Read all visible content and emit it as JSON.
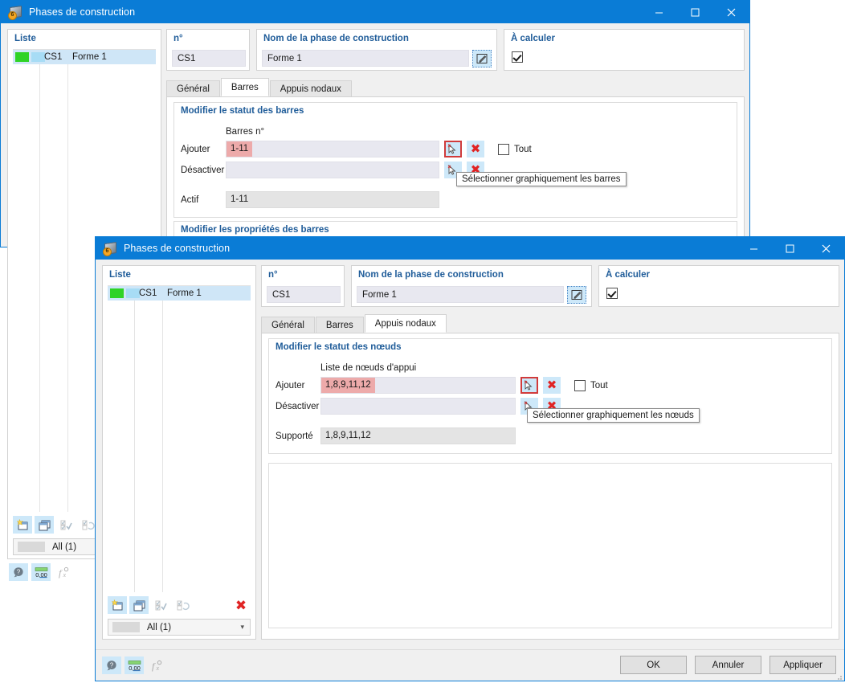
{
  "window1": {
    "title": "Phases de construction",
    "icon": "app-cube-icon",
    "controls": {
      "minimize": "minimize-icon",
      "maximize": "maximize-icon",
      "close": "close-icon"
    },
    "list": {
      "header": "Liste",
      "rows": [
        {
          "swatch1": "#2fd326",
          "swatch2": "#a7dcf5",
          "no": "CS1",
          "name": "Forme 1"
        }
      ],
      "toolbar": [
        "new-item-icon",
        "copy-item-icon",
        "check-all-icon",
        "toggle-check-icon"
      ],
      "filter": "All (1)"
    },
    "fields": {
      "no_label": "n°",
      "no_value": "CS1",
      "name_label": "Nom de la phase de construction",
      "name_value": "Forme 1",
      "edit_icon": "pencil-edit-icon",
      "calc_label": "À calculer",
      "calc_checked": true
    },
    "tabs": [
      {
        "label": "Général",
        "active": false
      },
      {
        "label": "Barres",
        "active": true
      },
      {
        "label": "Appuis nodaux",
        "active": false
      }
    ],
    "status_group": {
      "title": "Modifier le statut des barres",
      "column_header": "Barres n°",
      "rows": [
        {
          "label": "Ajouter",
          "value": "1-11",
          "selected": true
        },
        {
          "label": "Désactiver",
          "value": "",
          "selected": false
        }
      ],
      "active_label": "Actif",
      "active_value": "1-11",
      "all_checkbox": "Tout",
      "all_checked": false,
      "pick_icon": "graphic-select-icon",
      "clear_icon": "clear-red-x-icon",
      "tooltip": "Sélectionner graphiquement les barres"
    },
    "props_group": {
      "title": "Modifier les propriétés des barres"
    },
    "statusbar_icons": [
      "help-icon",
      "units-icon",
      "formula-icon"
    ]
  },
  "window2": {
    "title": "Phases de construction",
    "icon": "app-cube-icon",
    "controls": {
      "minimize": "minimize-icon",
      "maximize": "maximize-icon",
      "close": "close-icon"
    },
    "list": {
      "header": "Liste",
      "rows": [
        {
          "swatch1": "#2fd326",
          "swatch2": "#a7dcf5",
          "no": "CS1",
          "name": "Forme 1"
        }
      ],
      "toolbar": [
        "new-item-icon",
        "copy-item-icon",
        "check-all-icon",
        "toggle-check-icon"
      ],
      "delete_icon": "delete-red-x-icon",
      "filter": "All (1)"
    },
    "fields": {
      "no_label": "n°",
      "no_value": "CS1",
      "name_label": "Nom de la phase de construction",
      "name_value": "Forme 1",
      "edit_icon": "pencil-edit-icon",
      "calc_label": "À calculer",
      "calc_checked": true
    },
    "tabs": [
      {
        "label": "Général",
        "active": false
      },
      {
        "label": "Barres",
        "active": false
      },
      {
        "label": "Appuis nodaux",
        "active": true
      }
    ],
    "status_group": {
      "title": "Modifier le statut des nœuds",
      "column_header": "Liste de nœuds d'appui",
      "rows": [
        {
          "label": "Ajouter",
          "value": "1,8,9,11,12",
          "selected": true
        },
        {
          "label": "Désactiver",
          "value": "",
          "selected": false
        }
      ],
      "supported_label": "Supporté",
      "supported_value": "1,8,9,11,12",
      "all_checkbox": "Tout",
      "all_checked": false,
      "pick_icon": "graphic-select-icon",
      "clear_icon": "clear-red-x-icon",
      "tooltip": "Sélectionner graphiquement les nœuds"
    },
    "statusbar_icons": [
      "help-icon",
      "units-icon",
      "formula-icon"
    ],
    "buttons": {
      "ok": "OK",
      "cancel": "Annuler",
      "apply": "Appliquer"
    }
  },
  "colors": {
    "title_blue": "#0a7cd6",
    "legend_blue": "#1f5c99",
    "selection_pink": "#edaaaa",
    "row_highlight": "#cfe6f7",
    "icon_blue_bg": "#cde8f9",
    "red": "#e02424",
    "swatch_green": "#2fd326",
    "swatch_blue": "#a7dcf5"
  }
}
